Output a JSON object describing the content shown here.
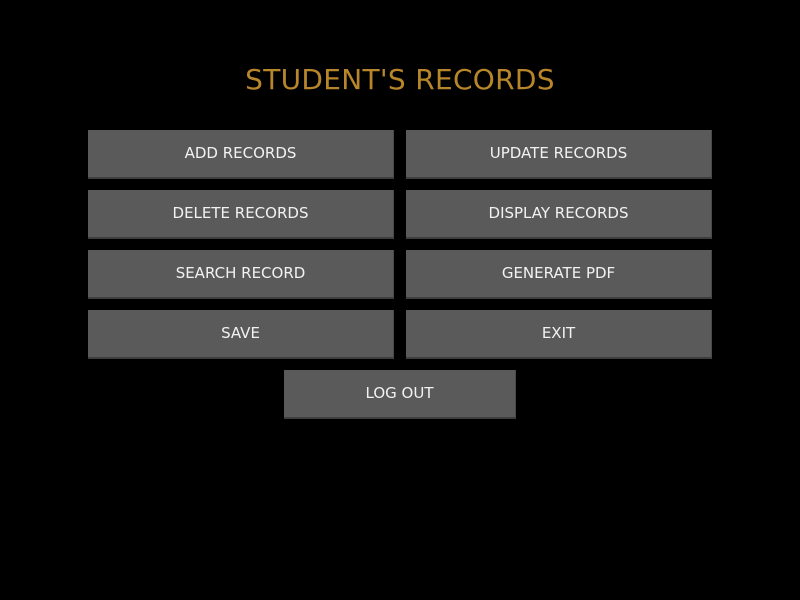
{
  "title": "STUDENT'S RECORDS",
  "buttons": {
    "add_records": "ADD RECORDS",
    "update_records": "UPDATE RECORDS",
    "delete_records": "DELETE RECORDS",
    "display_records": "DISPLAY RECORDS",
    "search_record": "SEARCH RECORD",
    "generate_pdf": "GENERATE PDF",
    "save": "SAVE",
    "exit": "EXIT",
    "log_out": "LOG OUT"
  },
  "colors": {
    "background": "#000000",
    "title": "#b8862a",
    "button": "#5a5a5a",
    "button_text": "#f2f2f2"
  }
}
